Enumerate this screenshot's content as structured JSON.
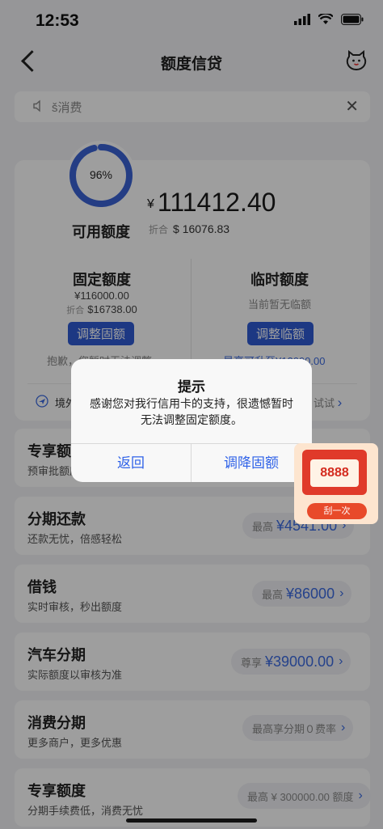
{
  "status": {
    "time": "12:53"
  },
  "header": {
    "title": "额度信贷"
  },
  "notice": {
    "text": "š消费"
  },
  "summary": {
    "percent_text": "96%",
    "percent": 0.96,
    "available_label": "可用额度",
    "currency_symbol": "¥",
    "amount": "111412.40",
    "converted_label": "折合",
    "converted_amount": "$ 16076.83"
  },
  "fixed_limit": {
    "title": "固定额度",
    "amount": "¥116000.00",
    "converted_label": "折合",
    "converted_amount": "$16738.00",
    "button": "调整固额",
    "note": "抱歉，您暂时无法调整"
  },
  "temp_limit": {
    "title": "临时额度",
    "status": "当前暂无临额",
    "button": "调整临额",
    "note": "最高可升至¥12000.00"
  },
  "card_bottom": {
    "left_text": "境外",
    "right_text": "试试"
  },
  "rows": [
    {
      "title": "专享额度",
      "subtitle": "预审批额度"
    },
    {
      "title": "分期还款",
      "subtitle": "还款无忧，倍感轻松",
      "pill_label": "最高",
      "pill_amount": "¥4541.00"
    },
    {
      "title": "借钱",
      "subtitle": "实时审核，秒出额度",
      "pill_label": "最高",
      "pill_amount": "¥86000"
    },
    {
      "title": "汽车分期",
      "subtitle": "实际额度以审核为准",
      "pill_label": "尊享",
      "pill_amount": "¥39000.00"
    },
    {
      "title": "消费分期",
      "subtitle": "更多商户，更多优惠",
      "pill_label": "最高享分期０费率",
      "pill_amount": ""
    },
    {
      "title": "专享额度",
      "subtitle": "分期手续费低，消费无忧",
      "pill_label": "最高 ¥ 300000.00 额度",
      "pill_amount": ""
    }
  ],
  "dialog": {
    "title": "提示",
    "message": "感谢您对我行信用卡的支持，很遗憾暂时无法调整固定额度。",
    "cancel": "返回",
    "confirm": "调降固额"
  },
  "promo": {
    "amount": "8888",
    "button": "刮一次"
  },
  "colors": {
    "accent": "#2f5bd3",
    "link": "#2f62e8",
    "ring": "#3b63d6"
  }
}
